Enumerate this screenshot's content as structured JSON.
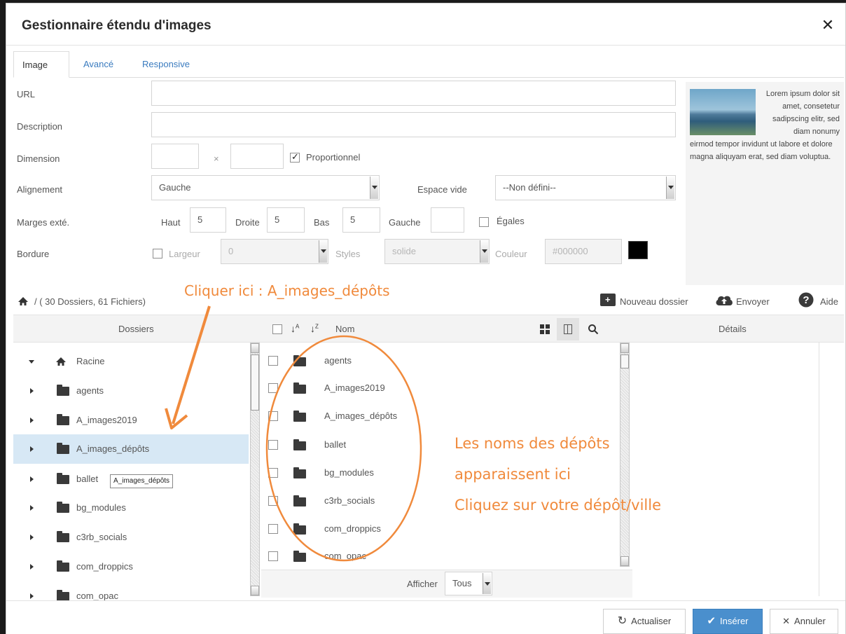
{
  "dialog": {
    "title": "Gestionnaire étendu d'images"
  },
  "tabs": [
    {
      "label": "Image"
    },
    {
      "label": "Avancé"
    },
    {
      "label": "Responsive"
    }
  ],
  "form": {
    "url_label": "URL",
    "description_label": "Description",
    "dimension_label": "Dimension",
    "dimension_times": "×",
    "proportionnel_label": "Proportionnel",
    "alignement_label": "Alignement",
    "alignement_value": "Gauche",
    "espace_vide_label": "Espace vide",
    "espace_vide_value": "--Non défini--",
    "marges_label": "Marges exté.",
    "haut_label": "Haut",
    "haut_value": "5",
    "droite_label": "Droite",
    "droite_value": "5",
    "bas_label": "Bas",
    "bas_value": "5",
    "gauche_label": "Gauche",
    "gauche_value": "",
    "egales_label": "Égales",
    "bordure_label": "Bordure",
    "largeur_label": "Largeur",
    "largeur_value": "0",
    "styles_label": "Styles",
    "styles_value": "solide",
    "couleur_label": "Couleur",
    "couleur_value": "#000000"
  },
  "preview": {
    "text_right": "Lorem ipsum dolor sit amet, consetetur sadipscing elitr, sed diam nonumy",
    "text_rest": "eirmod tempor invidunt ut labore et dolore magna aliquyam erat, sed diam voluptua."
  },
  "filemanager": {
    "path": "/ ( 30 Dossiers, 61 Fichiers)",
    "new_folder": "Nouveau dossier",
    "upload": "Envoyer",
    "help": "Aide",
    "col_folders": "Dossiers",
    "col_name": "Nom",
    "col_details": "Détails",
    "tree": [
      {
        "label": "Racine"
      },
      {
        "label": "agents"
      },
      {
        "label": "A_images2019"
      },
      {
        "label": "A_images_dépôts"
      },
      {
        "label": "ballet"
      },
      {
        "label": "bg_modules"
      },
      {
        "label": "c3rb_socials"
      },
      {
        "label": "com_droppics"
      },
      {
        "label": "com_opac"
      }
    ],
    "tooltip": "A_images_dépôts",
    "files": [
      {
        "label": "agents"
      },
      {
        "label": "A_images2019"
      },
      {
        "label": "A_images_dépôts"
      },
      {
        "label": "ballet"
      },
      {
        "label": "bg_modules"
      },
      {
        "label": "c3rb_socials"
      },
      {
        "label": "com_droppics"
      },
      {
        "label": "com_opac"
      }
    ],
    "show_label": "Afficher",
    "show_value": "Tous"
  },
  "footer": {
    "refresh": "Actualiser",
    "insert": "Insérer",
    "cancel": "Annuler"
  },
  "annotations": {
    "click_here": "Cliquer ici : A_images_dépôts",
    "line1": "Les noms des dépôts",
    "line2": "apparaissent ici",
    "line3": "Cliquez sur votre dépôt/ville"
  },
  "colors": {
    "accent": "#4a8fcd",
    "annotation": "#f08a3c",
    "selected_row": "#d7e8f5"
  },
  "icons": [
    "close-icon",
    "home-icon",
    "folder-icon",
    "new-folder-icon",
    "upload-cloud-icon",
    "help-icon",
    "sort-asc-icon",
    "sort-desc-icon",
    "grid-view-icon",
    "list-view-icon",
    "search-icon",
    "refresh-icon",
    "check-icon",
    "x-icon"
  ]
}
